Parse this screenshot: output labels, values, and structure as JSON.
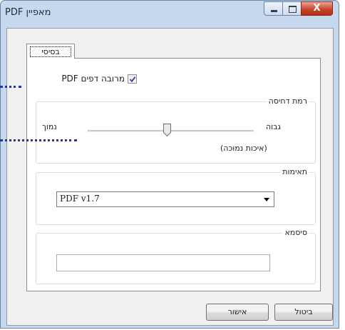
{
  "window": {
    "title": "מאפיין PDF",
    "close_glyph": "X"
  },
  "tab": {
    "label": "בסיסי"
  },
  "multipage": {
    "label": "מרובה דפים PDF",
    "checked": true
  },
  "compression": {
    "legend": "רמת דחיסה",
    "high_label": "גבוה",
    "low_label": "נמוך",
    "quality_label": "(איכות נמוכה)",
    "slider_level": 0.48
  },
  "compatibility": {
    "legend": "תאימות",
    "selected": "PDF v1.7"
  },
  "password": {
    "legend": "סיסמא",
    "value": ""
  },
  "buttons": {
    "ok": "אישור",
    "cancel": "ביטול"
  },
  "colors": {
    "window_frame": "#c5d8ee",
    "close_button": "#c9452b",
    "annotation_dots": "#1e36a8"
  }
}
